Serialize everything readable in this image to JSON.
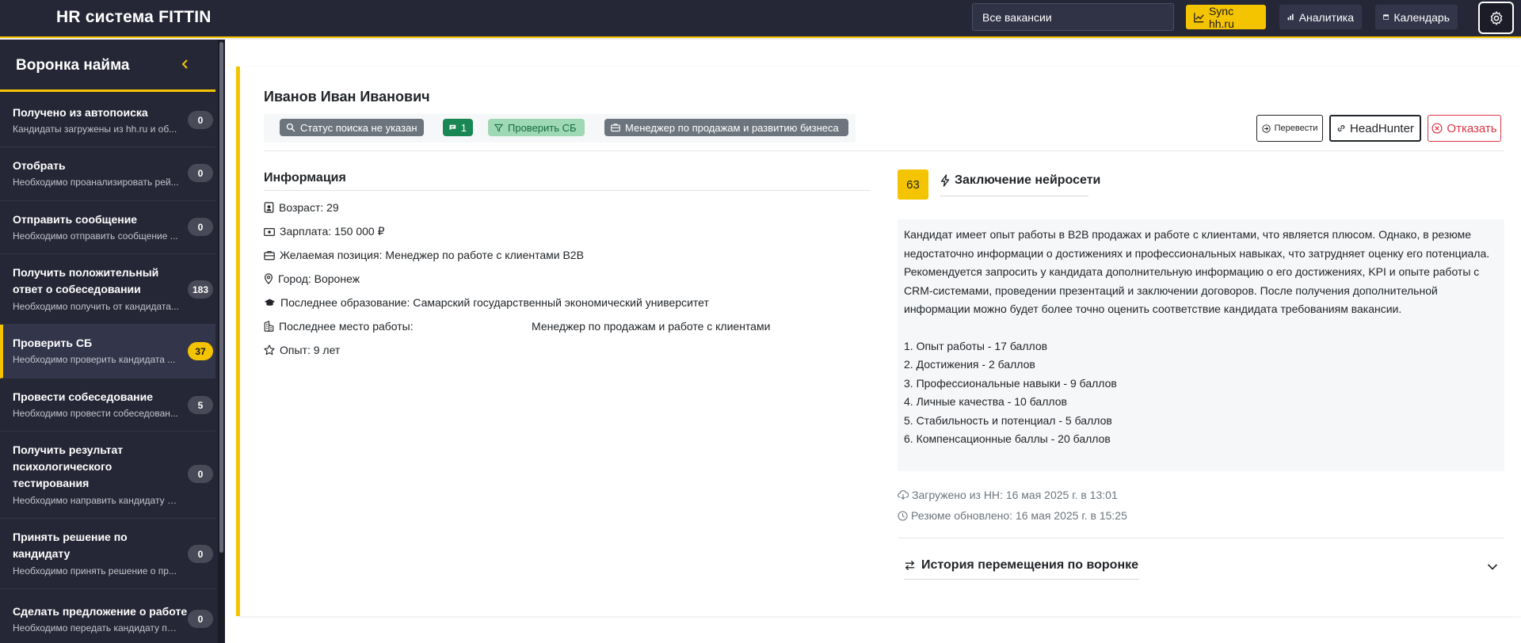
{
  "app": {
    "title": "HR система FITTIN"
  },
  "topbar": {
    "vacancy_select": "Все вакансии",
    "sync_label": "Sync hh.ru",
    "analytics_label": "Аналитика",
    "calendar_label": "Календарь",
    "accent_color": "#f5c400"
  },
  "sidebar": {
    "title": "Воронка найма",
    "items": [
      {
        "title": "Получено из автопоиска",
        "desc": "Кандидаты загружены из hh.ru и об...",
        "count": "0"
      },
      {
        "title": "Отобрать",
        "desc": "Необходимо проанализировать рей...",
        "count": "0"
      },
      {
        "title": "Отправить сообщение",
        "desc": "Необходимо отправить сообщение ...",
        "count": "0"
      },
      {
        "title": "Получить положительный ответ о собеседовании",
        "desc": "Необходимо получить от кандидата...",
        "count": "183"
      },
      {
        "title": "Проверить СБ",
        "desc": "Необходимо проверить кандидата ...",
        "count": "37"
      },
      {
        "title": "Провести собеседование",
        "desc": "Необходимо провести собеседован...",
        "count": "5"
      },
      {
        "title": "Получить результат психологического тестирования",
        "desc": "Необходимо направить кандидату с...",
        "count": "0"
      },
      {
        "title": "Принять решение по кандидату",
        "desc": "Необходимо принять решение о пр...",
        "count": "0"
      },
      {
        "title": "Сделать предложение о работе",
        "desc": "Необходимо передать кандидату пр...",
        "count": "0"
      }
    ]
  },
  "candidate": {
    "name": "Иванов Иван Иванович",
    "tags": {
      "search_status": "Статус поиска не указан",
      "comments": "1",
      "stage": "Проверить СБ",
      "position": "Менеджер по продажам и развитию бизнеса"
    },
    "actions": {
      "translate": "Перевести",
      "headhunter": "HeadHunter",
      "reject": "Отказать"
    },
    "info": {
      "title": "Информация",
      "age": "Возраст: 29",
      "salary": "Зарплата: 150 000 ₽",
      "desired_position": "Желаемая позиция: Менеджер по работе с клиентами B2B",
      "city": "Город: Воронеж",
      "education": "Последнее образование: Самарский государственный экономический университет",
      "last_work_label": "Последнее место работы:",
      "last_work_value": "Менеджер по продажам и работе с клиентами",
      "experience": "Опыт: 9 лет"
    },
    "ai": {
      "score": "63",
      "title": "Заключение нейросети",
      "summary": "Кандидат имеет опыт работы в B2B продажах и работе с клиентами, что является плюсом. Однако, в резюме недостаточно информации о достижениях и профессиональных навыках, что затрудняет оценку его потенциала. Рекомендуется запросить у кандидата дополнительную информацию о его достижениях, KPI и опыте работы с CRM-системами, проведении презентаций и заключении договоров. После получения дополнительной информации можно будет более точно оценить соответствие кандидата требованиям вакансии.",
      "scores": [
        "1. Опыт работы - 17 баллов",
        "2. Достижения - 2 баллов",
        "3. Профессиональные навыки - 9 баллов",
        "4. Личные качества - 10 баллов",
        "5. Стабильность и потенциал - 5 баллов",
        "6. Компенсационные баллы - 20 баллов"
      ]
    },
    "meta": {
      "loaded": "Загружено из HH: 16 мая 2025 г. в 13:01",
      "updated": "Резюме обновлено: 16 мая 2025 г. в 15:25"
    },
    "history_title": "История перемещения по воронке"
  }
}
